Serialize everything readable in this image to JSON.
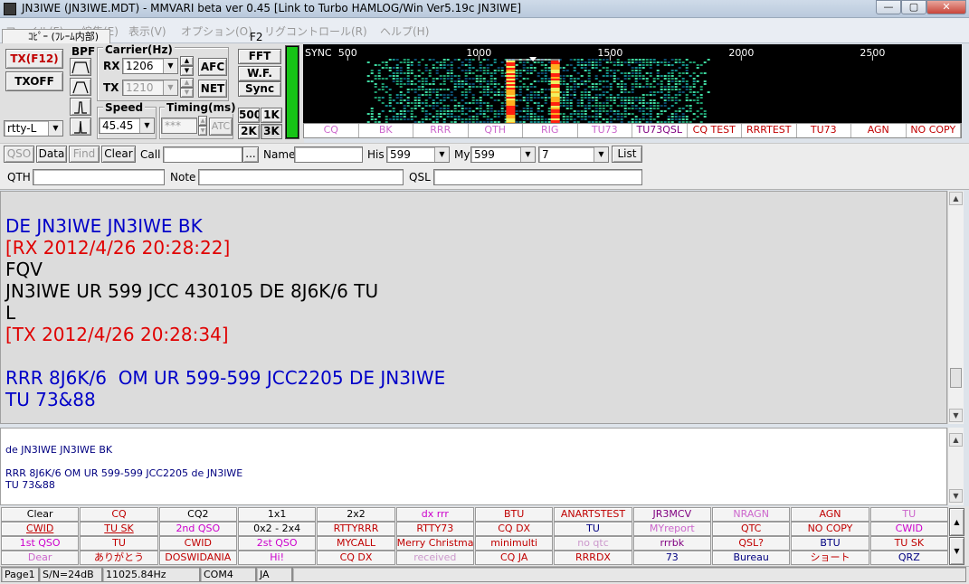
{
  "window": {
    "title": "JN3IWE (JN3IWE.MDT) - MMVARI beta ver 0.45 [Link to Turbo HAMLOG/Win Ver5.19c JN3IWE]",
    "min": "—",
    "max": "▢",
    "close": "✕"
  },
  "menu": [
    {
      "label": "ファイル(F)"
    },
    {
      "label": "編集(E)"
    },
    {
      "label": "表示(V)"
    },
    {
      "label": "オプション(O)"
    },
    {
      "label": "リグコントロール(R)"
    },
    {
      "label": "ヘルプ(H)"
    }
  ],
  "menu_popup": {
    "label": "ｺﾋﾟｰ (ﾌﾚｰﾑ内部)",
    "f2": "F2"
  },
  "tx": {
    "tx_label": "TX(F12)",
    "txoff_label": "TXOFF",
    "mode_value": "rtty-L"
  },
  "bpf": {
    "label": "BPF"
  },
  "carrier": {
    "label": "Carrier(Hz)",
    "rx_label": "RX",
    "rx_value": "1206",
    "tx_label": "TX",
    "tx_value": "1210",
    "afc_label": "AFC",
    "net_label": "NET"
  },
  "speed": {
    "label": "Speed",
    "value": "45.45"
  },
  "timing": {
    "label": "Timing(ms)",
    "value": "***",
    "atc_label": "ATC"
  },
  "view_buttons": {
    "fft": "FFT",
    "wf": "W.F.",
    "sync": "Sync",
    "b500": "500",
    "b1k": "1K",
    "b2k": "2K",
    "b3k": "3K"
  },
  "waterfall": {
    "sync_label": "SYNC",
    "freq_labels": [
      "500",
      "1000",
      "1500",
      "2000",
      "2500"
    ],
    "marker": "1206",
    "quick_buttons": [
      {
        "label": "CQ",
        "color": "#cc66cc"
      },
      {
        "label": "BK",
        "color": "#cc66cc"
      },
      {
        "label": "RRR",
        "color": "#cc66cc"
      },
      {
        "label": "QTH",
        "color": "#cc66cc"
      },
      {
        "label": "RIG",
        "color": "#cc66cc"
      },
      {
        "label": "TU73",
        "color": "#cc66cc"
      },
      {
        "label": "TU73QSL",
        "color": "#800080"
      },
      {
        "label": "CQ TEST",
        "color": "#c00000"
      },
      {
        "label": "RRRTEST",
        "color": "#c00000"
      },
      {
        "label": "TU73",
        "color": "#c00000"
      },
      {
        "label": "AGN",
        "color": "#c00000"
      },
      {
        "label": "NO COPY",
        "color": "#c00000"
      }
    ]
  },
  "qso_bar": {
    "qso": "QSO",
    "data": "Data",
    "find": "Find",
    "clear": "Clear",
    "call_label": "Call",
    "call_value": "",
    "dots": "...",
    "name_label": "Name",
    "name_value": "",
    "his_label": "His",
    "his_value": "599",
    "my_label": "My",
    "my_value": "599",
    "extra_value": "7",
    "list": "List",
    "qth_label": "QTH",
    "qth_value": "",
    "note_label": "Note",
    "note_value": "",
    "qsl_label": "QSL",
    "qsl_value": ""
  },
  "rx_lines": [
    {
      "text": "",
      "color": "#000000"
    },
    {
      "text": "DE JN3IWE JN3IWE BK",
      "color": "#0000c8"
    },
    {
      "text": "[RX 2012/4/26 20:28:22]",
      "color": "#e00000"
    },
    {
      "text": "FQV",
      "color": "#000000"
    },
    {
      "text": "JN3IWE UR 599 JCC 430105 DE 8J6K/6 TU",
      "color": "#000000"
    },
    {
      "text": "L",
      "color": "#000000"
    },
    {
      "text": "[TX 2012/4/26 20:28:34]",
      "color": "#e00000"
    },
    {
      "text": "",
      "color": "#000000"
    },
    {
      "text": "RRR 8J6K/6  OM UR 599-599 JCC2205 DE JN3IWE",
      "color": "#0000c8"
    },
    {
      "text": "TU 73&88",
      "color": "#0000c8"
    }
  ],
  "tx_lines": [
    {
      "text": "de JN3IWE JN3IWE BK",
      "color": "#000080"
    },
    {
      "text": "",
      "color": "#000080"
    },
    {
      "text": "RRR 8J6K/6  OM UR 599-599 JCC2205 de JN3IWE",
      "color": "#000080"
    },
    {
      "text": "TU 73&88",
      "color": "#000080"
    }
  ],
  "macros": [
    [
      {
        "label": "Clear",
        "color": "#000000",
        "u": false
      },
      {
        "label": "CQ",
        "color": "#c00000",
        "u": false
      },
      {
        "label": "CQ2",
        "color": "#000000",
        "u": false
      },
      {
        "label": "1x1",
        "color": "#000000",
        "u": false
      },
      {
        "label": "2x2",
        "color": "#000000",
        "u": false
      },
      {
        "label": "dx rrr",
        "color": "#cc00cc",
        "u": false
      },
      {
        "label": "BTU",
        "color": "#c00000",
        "u": false
      },
      {
        "label": "ANARTSTEST",
        "color": "#c00000",
        "u": false
      },
      {
        "label": "JR3MCV",
        "color": "#800080",
        "u": false
      },
      {
        "label": "NRAGN",
        "color": "#cc66cc",
        "u": false
      },
      {
        "label": "AGN",
        "color": "#c00000",
        "u": false
      },
      {
        "label": "TU",
        "color": "#cc66cc",
        "u": false
      }
    ],
    [
      {
        "label": "CWID",
        "color": "#c00000",
        "u": true
      },
      {
        "label": "TU SK",
        "color": "#c00000",
        "u": true
      },
      {
        "label": "2nd QSO",
        "color": "#cc00cc",
        "u": false
      },
      {
        "label": "0x2 - 2x4",
        "color": "#000000",
        "u": false
      },
      {
        "label": "RTTYRRR",
        "color": "#c00000",
        "u": false
      },
      {
        "label": "RTTY73",
        "color": "#c00000",
        "u": false
      },
      {
        "label": "CQ DX",
        "color": "#c00000",
        "u": false
      },
      {
        "label": "TU",
        "color": "#000080",
        "u": false
      },
      {
        "label": "MYreport",
        "color": "#cc66cc",
        "u": false
      },
      {
        "label": "QTC",
        "color": "#c00000",
        "u": false
      },
      {
        "label": "NO COPY",
        "color": "#c00000",
        "u": false
      },
      {
        "label": "CWID",
        "color": "#cc00cc",
        "u": false
      }
    ],
    [
      {
        "label": "1st QSO",
        "color": "#cc00cc",
        "u": false
      },
      {
        "label": "TU",
        "color": "#c00000",
        "u": false
      },
      {
        "label": "CWID",
        "color": "#c00000",
        "u": false
      },
      {
        "label": "2st QSO",
        "color": "#cc00cc",
        "u": false
      },
      {
        "label": "MYCALL",
        "color": "#c00000",
        "u": false
      },
      {
        "label": "Merry Christmas",
        "color": "#c00000",
        "u": false
      },
      {
        "label": "minimulti",
        "color": "#c00000",
        "u": false
      },
      {
        "label": "no qtc",
        "color": "#cc99cc",
        "u": false
      },
      {
        "label": "rrrbk",
        "color": "#800080",
        "u": false
      },
      {
        "label": "QSL?",
        "color": "#c00000",
        "u": false
      },
      {
        "label": "BTU",
        "color": "#000080",
        "u": false
      },
      {
        "label": "TU SK",
        "color": "#c00000",
        "u": false
      }
    ],
    [
      {
        "label": "Dear",
        "color": "#cc66cc",
        "u": false
      },
      {
        "label": "ありがとう",
        "color": "#c00000",
        "u": false
      },
      {
        "label": "DOSWIDANIA",
        "color": "#c00000",
        "u": false
      },
      {
        "label": "Hi!",
        "color": "#cc00cc",
        "u": false
      },
      {
        "label": "CQ DX",
        "color": "#c00000",
        "u": false
      },
      {
        "label": "received",
        "color": "#cc99cc",
        "u": false
      },
      {
        "label": "CQ JA",
        "color": "#c00000",
        "u": false
      },
      {
        "label": "RRRDX",
        "color": "#c00000",
        "u": false
      },
      {
        "label": "73",
        "color": "#000080",
        "u": false
      },
      {
        "label": "Bureau",
        "color": "#000080",
        "u": false
      },
      {
        "label": "ショート",
        "color": "#c00000",
        "u": false
      },
      {
        "label": "QRZ",
        "color": "#000080",
        "u": false
      }
    ]
  ],
  "status": {
    "page": "Page1",
    "sn": "S/N=24dB",
    "clock": "11025.84Hz",
    "port": "COM4",
    "lang": "JA"
  }
}
